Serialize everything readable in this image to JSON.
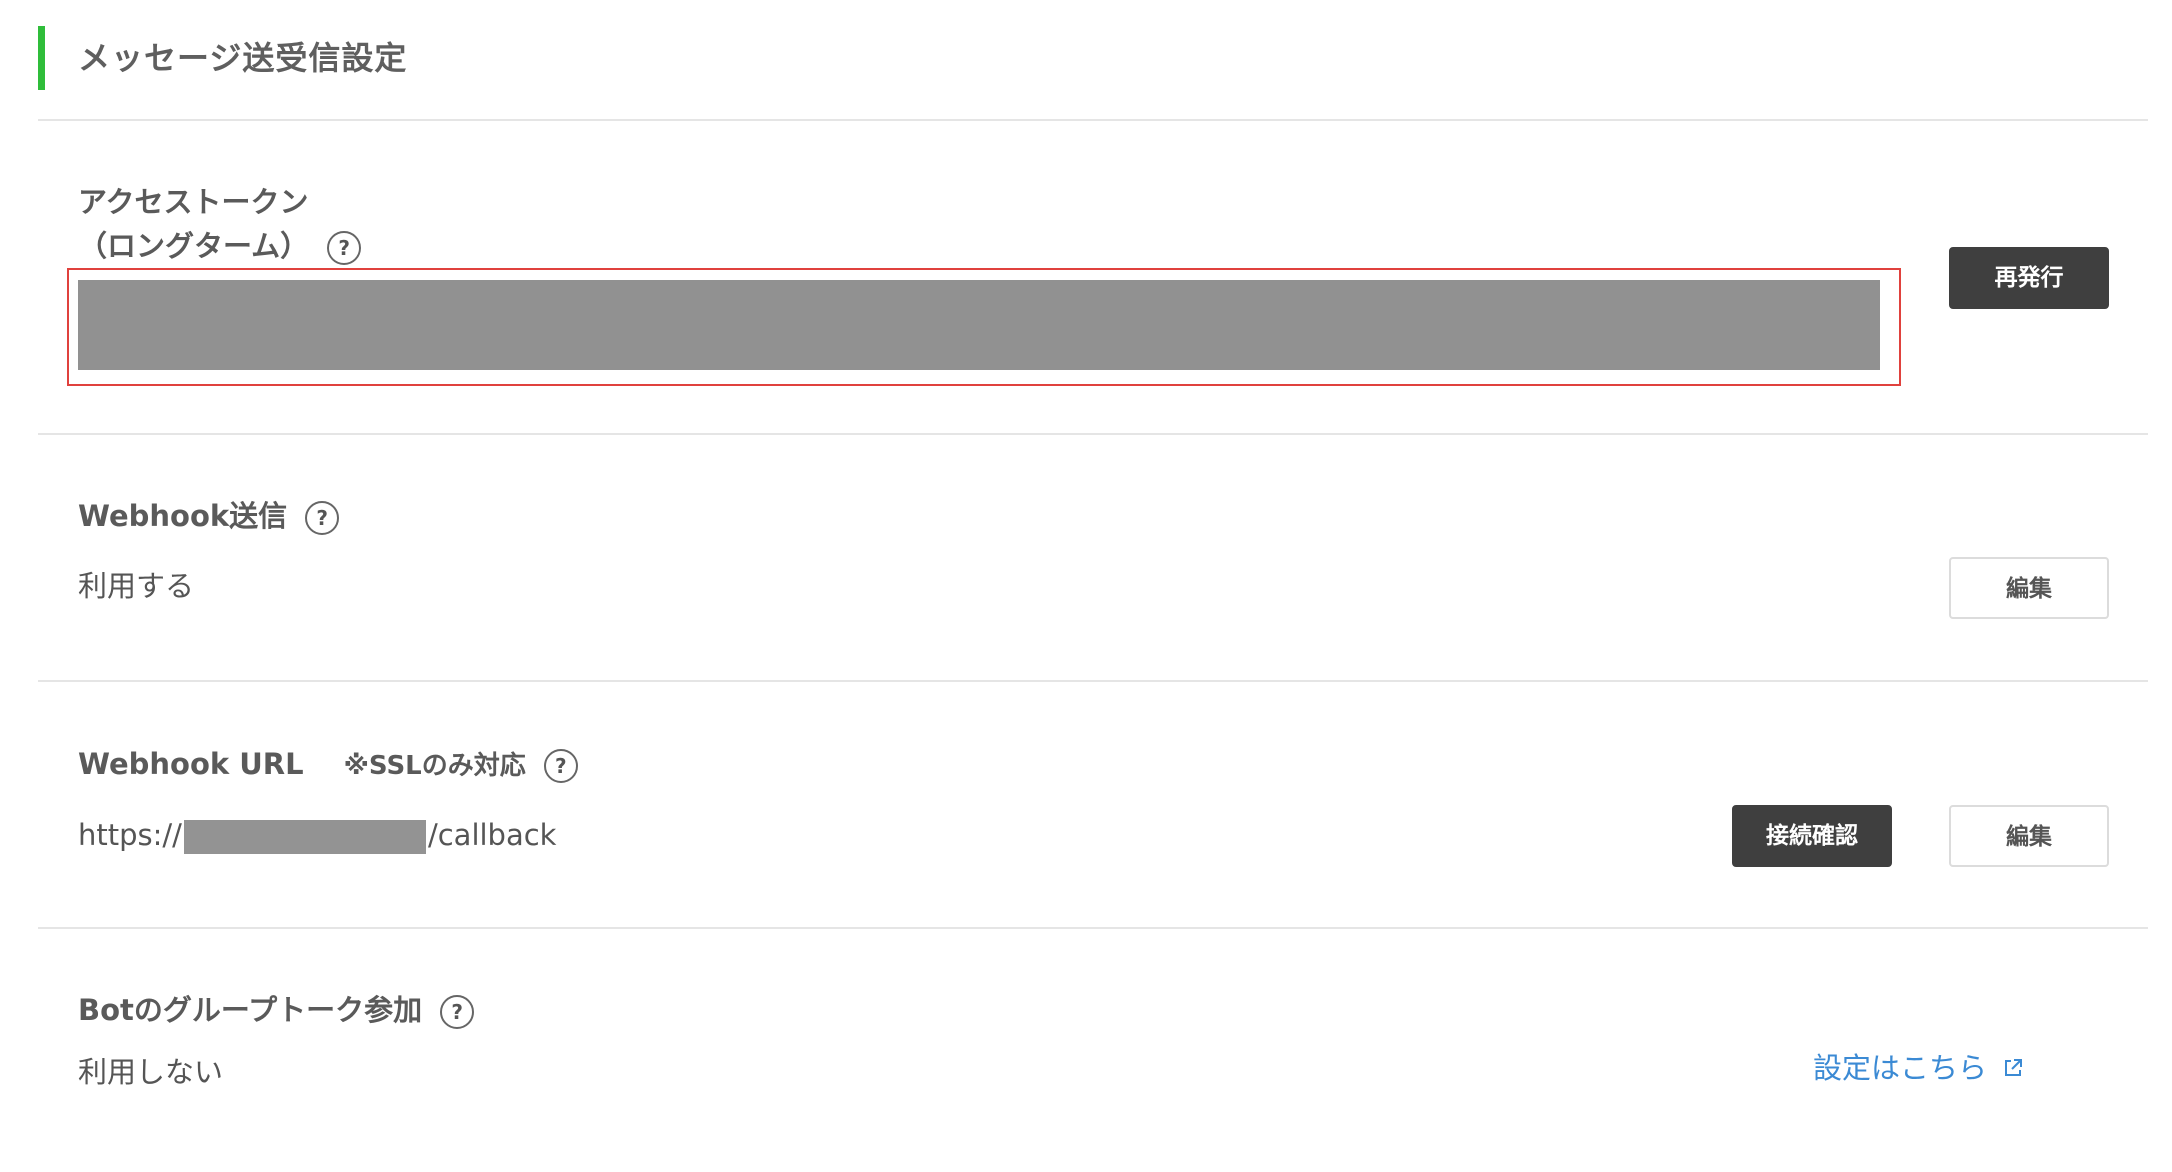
{
  "header": {
    "title": "メッセージ送受信設定",
    "accent_color": "#2fbd3a"
  },
  "access_token": {
    "label_line1": "アクセストークン",
    "label_line2": "（ロングターム）",
    "help": "?",
    "reissue_button": "再発行",
    "highlight_color": "#e0413d"
  },
  "webhook_send": {
    "label": "Webhook送信",
    "help": "?",
    "value": "利用する",
    "edit_button": "編集"
  },
  "webhook_url": {
    "label": "Webhook URL",
    "note": "※SSLのみ対応",
    "help": "?",
    "value_prefix": "https://",
    "value_suffix": "/callback",
    "verify_button": "接続確認",
    "edit_button": "編集"
  },
  "bot_group": {
    "label": "Botのグループトーク参加",
    "help": "?",
    "value": "利用しない",
    "link": "設定はこちら",
    "link_icon": "external-link-icon",
    "link_color": "#3b8ad4"
  }
}
